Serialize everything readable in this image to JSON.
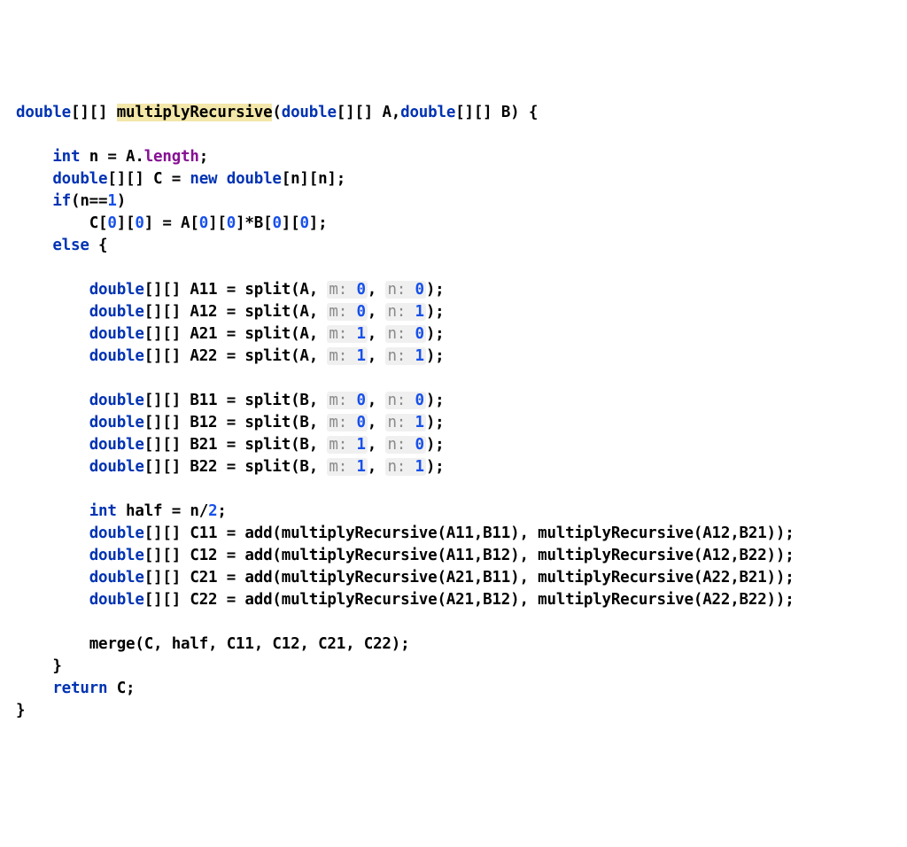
{
  "code": {
    "sig_kw_double": "double",
    "sig_brackets": "[][]",
    "sig_method": "multiplyRecursive",
    "sig_paren_open": "(",
    "sig_param_a": "[][] A,",
    "sig_param_b": "[][] B) {",
    "line_int_n": "int",
    "line_n_decl": " n = A.",
    "line_n_length": "length",
    "line_n_end": ";",
    "line_c_decl_a": "[][] C = ",
    "line_c_new": "new double",
    "line_c_decl_b": "[n][n];",
    "line_if": "if",
    "line_if_cond_a": "(n==",
    "num_1": "1",
    "line_if_cond_b": ")",
    "line_c00_a": "C[",
    "num_0": "0",
    "line_c00_b": "][",
    "line_c00_c": "] = A[",
    "line_c00_d": "]*B[",
    "line_c00_e": "];",
    "line_else": "else",
    "line_else_brace": " {",
    "decl_double": "double",
    "decl_br": "[][]",
    "a11": " A11 = split(A, ",
    "a12": " A12 = split(A, ",
    "a21": " A21 = split(A, ",
    "a22": " A22 = split(A, ",
    "b11": " B11 = split(B, ",
    "b12": " B12 = split(B, ",
    "b21": " B21 = split(B, ",
    "b22": " B22 = split(B, ",
    "hint_m": "m:",
    "hint_n": "n:",
    "close_paren_semi": ");",
    "half_int": "int",
    "half_decl_a": " half = n/",
    "num_2": "2",
    "half_decl_b": ";",
    "c11": " C11 = add(multiplyRecursive(A11,B11), multiplyRecursive(A12,B21));",
    "c12": " C12 = add(multiplyRecursive(A11,B12), multiplyRecursive(A12,B22));",
    "c21": " C21 = add(multiplyRecursive(A21,B11), multiplyRecursive(A22,B21));",
    "c22": " C22 = add(multiplyRecursive(A21,B12), multiplyRecursive(A22,B22));",
    "merge": "merge(C, half, C11, C12, C21, C22);",
    "close_brace": "}",
    "return_kw": "return",
    "return_val": " C;",
    "final_brace": "}"
  }
}
